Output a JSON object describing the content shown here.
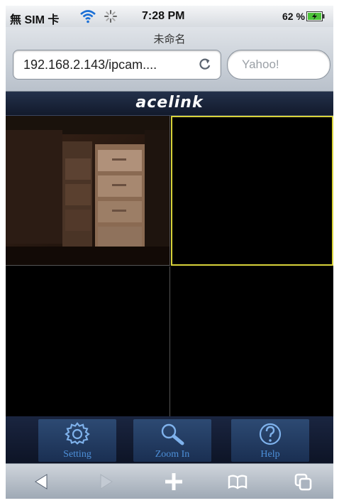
{
  "status_bar": {
    "carrier": "無 SIM 卡",
    "time": "7:28 PM",
    "battery_percent": "62 %"
  },
  "browser": {
    "page_title": "未命名",
    "url": "192.168.2.143/ipcam....",
    "search_placeholder": "Yahoo!"
  },
  "brand": {
    "logo_text": "acelink"
  },
  "camera_grid": {
    "cells": [
      {
        "id": 1,
        "has_feed": true,
        "selected": false
      },
      {
        "id": 2,
        "has_feed": false,
        "selected": true
      },
      {
        "id": 3,
        "has_feed": false,
        "selected": false
      },
      {
        "id": 4,
        "has_feed": false,
        "selected": false
      }
    ],
    "selected_border_color": "#d8d23a"
  },
  "toolbar": {
    "setting_label": "Setting",
    "zoom_label": "Zoom In",
    "help_label": "Help",
    "label_color": "#4d8fd8"
  },
  "safari_toolbar": {
    "buttons": [
      "back-icon",
      "forward-icon",
      "add-icon",
      "bookmarks-icon",
      "pages-icon"
    ]
  }
}
